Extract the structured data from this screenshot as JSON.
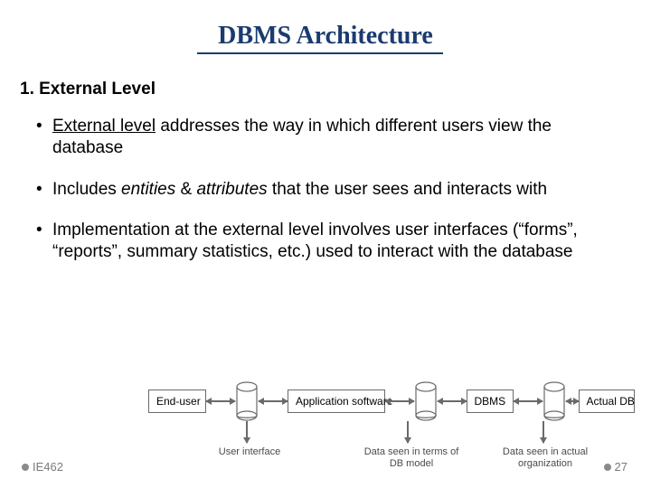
{
  "title": "DBMS Architecture",
  "subtitle": "1. External Level",
  "bullets": [
    {
      "prefix": "External level",
      "rest": " addresses the way in which different users view the database",
      "prefix_underline": true
    },
    {
      "parts": [
        "Includes ",
        "entities",
        " & ",
        "attributes",
        " that the user sees and interacts with"
      ],
      "italics": [
        1,
        3
      ]
    },
    {
      "text": "Implementation at the external level involves user interfaces (“forms”, “reports”, summary statistics, etc.) used to interact with the database"
    }
  ],
  "diagram": {
    "boxes": [
      "End-user",
      "Application software",
      "DBMS",
      "Actual DB"
    ],
    "captions": [
      "User interface",
      "Data seen in terms of DB model",
      "Data seen in actual organization"
    ]
  },
  "footer": {
    "course": "IE462",
    "page": "27"
  }
}
